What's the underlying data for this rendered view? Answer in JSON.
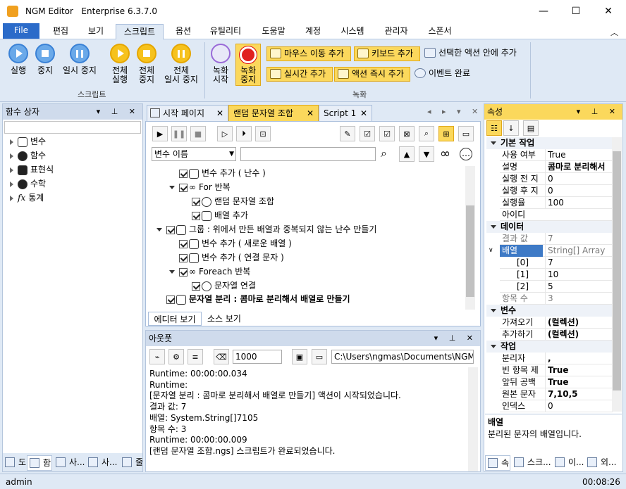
{
  "window": {
    "title": "NGM Editor",
    "edition": "Enterprise 6.3.7.0",
    "minimize": "—",
    "maximize": "☐",
    "close": "✕"
  },
  "menu_tabs": [
    "File",
    "편집",
    "보기",
    "스크립트",
    "옵션",
    "유틸리티",
    "도움말",
    "계정",
    "시스템",
    "관리자",
    "스폰서"
  ],
  "ribbon": {
    "run": "실행",
    "stop": "중지",
    "pause": "일시 중지",
    "run_all_1": "전체",
    "run_all_2": "실행",
    "stop_all_1": "전체",
    "stop_all_2": "중지",
    "pause_all_1": "전체",
    "pause_all_2": "일시 중지",
    "record_start_1": "녹화",
    "record_start_2": "시작",
    "record_stop_1": "녹화",
    "record_stop_2": "중지",
    "add_mouse_move": "마우스 이동 추가",
    "add_keyboard": "키보드 추가",
    "add_inside_action": "선택한 액션 안에 추가",
    "add_realtime": "실시간 추가",
    "add_action_immediate": "액션 즉시 추가",
    "event_complete": "이벤트 완료",
    "group_script": "스크립트",
    "group_record": "녹화"
  },
  "func_box": {
    "title": "함수 상자",
    "items": [
      "변수",
      "함수",
      "표현식",
      "수학",
      "통계"
    ]
  },
  "doc_tabs": {
    "start_page": "시작 페이지",
    "random_string": "랜덤 문자열 조합",
    "script1": "Script 1"
  },
  "editor": {
    "var_name": "변수 이름",
    "rows": [
      "변수 추가 ( 난수 )",
      "For 반복",
      "랜덤 문자열 조합",
      "배열 추가",
      "그룹 : 위에서 만든 배열과 중복되지 않는 난수 만들기",
      "변수 추가 ( 새로운 배열 )",
      "변수 추가 ( 연결 문자 )",
      "Foreach 반복",
      "문자열 연결",
      "문자열 분리 : 콤마로 분리해서 배열로 만들기"
    ],
    "view_editor": "에디터 보기",
    "view_source": "소스 보기"
  },
  "output": {
    "title": "아웃풋",
    "count": "1000",
    "path": "C:\\Users\\ngmas\\Documents\\NGM6\\",
    "lines": [
      "Runtime: 00:00:00.034",
      "Runtime:",
      "[문자열 분리 : 콤마로 분리해서 배열로 만들기] 액션이 시작되었습니다.",
      "결과 값: 7",
      "배열: System.String[]7105",
      "항목 수: 3",
      "Runtime: 00:00:00.009",
      "[랜덤 문자열 조합.ngs] 스크립트가 완료되었습니다."
    ]
  },
  "properties": {
    "title": "속성",
    "cat_basic": "기본 작업",
    "basic": [
      {
        "name": "사용 여부",
        "value": "True"
      },
      {
        "name": "설명",
        "value": "콤마로 분리해서"
      },
      {
        "name": "실행 전 지",
        "value": "0"
      },
      {
        "name": "실행 후 지",
        "value": "0"
      },
      {
        "name": "실행율",
        "value": "100"
      },
      {
        "name": "아이디",
        "value": ""
      }
    ],
    "cat_data": "데이터",
    "data": [
      {
        "name": "결과 값",
        "value": "7"
      },
      {
        "name": "배열",
        "value": "String[] Array"
      },
      {
        "name": "[0]",
        "value": "7"
      },
      {
        "name": "[1]",
        "value": "10"
      },
      {
        "name": "[2]",
        "value": "5"
      },
      {
        "name": "항목 수",
        "value": "3"
      }
    ],
    "cat_var": "변수",
    "var": [
      {
        "name": "가져오기",
        "value": "(컬렉션)"
      },
      {
        "name": "추가하기",
        "value": "(컬렉션)"
      }
    ],
    "cat_work": "작업",
    "work": [
      {
        "name": "분리자",
        "value": ","
      },
      {
        "name": "빈 항목 제",
        "value": "True"
      },
      {
        "name": "앞뒤 공백",
        "value": "True"
      },
      {
        "name": "원본 문자",
        "value": "7,10,5"
      },
      {
        "name": "인덱스",
        "value": "0"
      }
    ],
    "desc_title": "배열",
    "desc_text": "분리된 문자의 배열입니다."
  },
  "bottom_tabs_left": [
    "도",
    "함",
    "사...",
    "사...",
    "줄"
  ],
  "bottom_tabs_right": [
    "속",
    "스크...",
    "이...",
    "외..."
  ],
  "status": {
    "user": "admin",
    "time": "00:08:26"
  }
}
